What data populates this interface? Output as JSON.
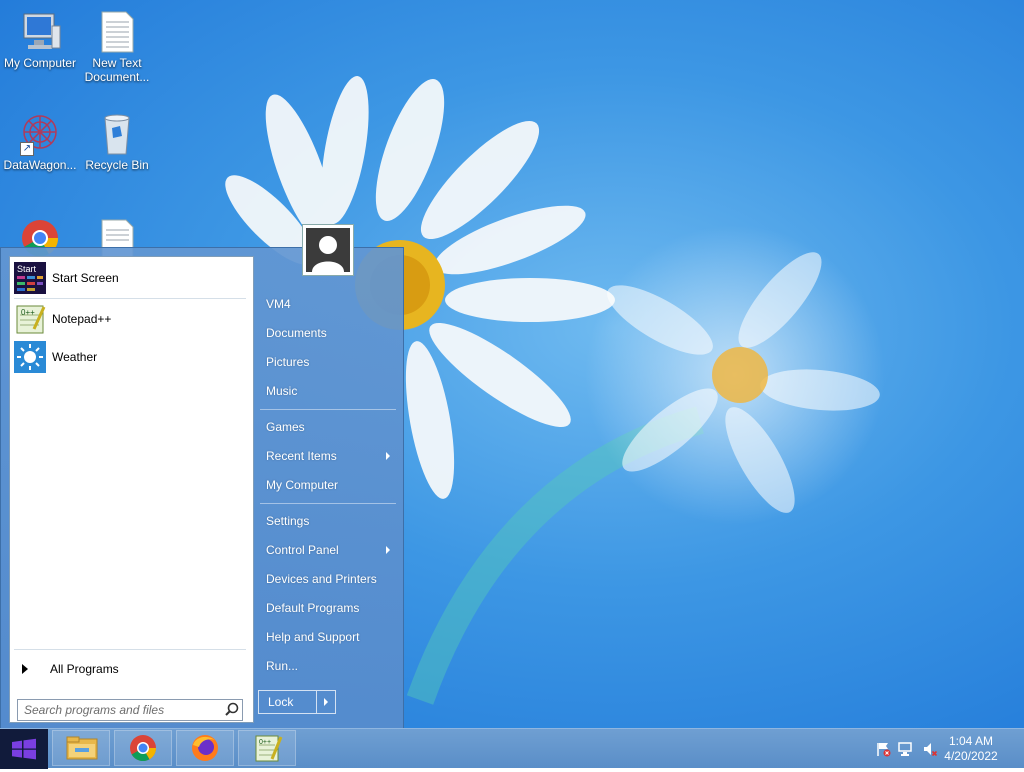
{
  "desktop": {
    "icons": [
      {
        "label": "My Computer"
      },
      {
        "label": "New Text Document..."
      },
      {
        "label": "DataWagon..."
      },
      {
        "label": "Recycle Bin"
      },
      {
        "label": "Google Chrome"
      },
      {
        "label": "Text Document"
      }
    ]
  },
  "start_menu": {
    "pinned": [
      {
        "label": "Start Screen",
        "icon": "start-screen-icon",
        "badge": "Start"
      },
      {
        "label": "Notepad++",
        "icon": "notepad-plus-plus-icon"
      },
      {
        "label": "Weather",
        "icon": "weather-icon"
      }
    ],
    "all_programs": "All Programs",
    "search": {
      "placeholder": "Search programs and files"
    },
    "places": {
      "group1": [
        "VM4",
        "Documents",
        "Pictures",
        "Music"
      ],
      "group2": [
        "Games",
        "Recent Items",
        "My Computer"
      ],
      "group3": [
        "Settings",
        "Control Panel",
        "Devices and Printers",
        "Default Programs",
        "Help and Support",
        "Run..."
      ]
    },
    "lock_label": "Lock"
  },
  "taskbar": {
    "apps": [
      "File Explorer",
      "Google Chrome",
      "Firefox",
      "Notepad++"
    ],
    "clock": {
      "time": "1:04 AM",
      "date": "4/20/2022"
    }
  },
  "colors": {
    "accent": "#5a8ec8",
    "start_button": "#111b3b",
    "wallpaper": "#3d97e4"
  }
}
